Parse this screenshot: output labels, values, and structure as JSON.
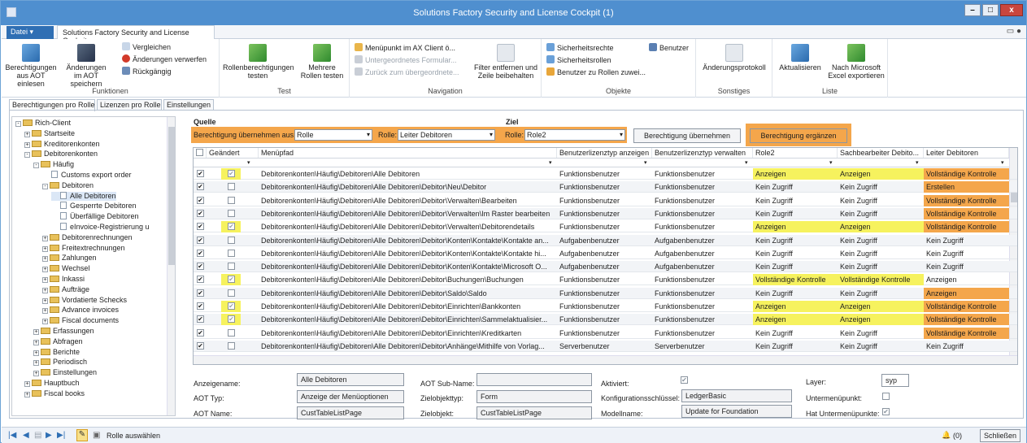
{
  "window": {
    "title": "Solutions Factory Security and License Cockpit (1)"
  },
  "menubar": {
    "file": "Datei",
    "tab": "Solutions Factory Security and License Cockpit"
  },
  "ribbon": {
    "funktionen": {
      "title": "Funktionen",
      "load": "Berechtigungen aus AOT einlesen",
      "save": "Änderungen im AOT speichern",
      "compare": "Vergleichen",
      "discard": "Änderungen verwerfen",
      "undo": "Rückgängig"
    },
    "test": {
      "title": "Test",
      "test_roles": "Rollenberechtigungen testen",
      "multi": "Mehrere Rollen testen"
    },
    "navigation": {
      "title": "Navigation",
      "open_ax": "Menüpunkt im AX Client ö...",
      "sub_form": "Untergeordnetes Formular...",
      "back": "Zurück zum übergeordnete...",
      "filter": "Filter entfernen und Zeile beibehalten"
    },
    "objekte": {
      "title": "Objekte",
      "rights": "Sicherheitsrechte",
      "roles": "Sicherheitsrollen",
      "assign": "Benutzer zu Rollen zuwei...",
      "users": "Benutzer"
    },
    "sonstiges": {
      "title": "Sonstiges",
      "log": "Änderungsprotokoll"
    },
    "liste": {
      "title": "Liste",
      "refresh": "Aktualisieren",
      "excel": "Nach Microsoft Excel exportieren"
    }
  },
  "tabs": [
    "Berechtigungen pro Rolle",
    "Lizenzen pro Rolle",
    "Einstellungen"
  ],
  "tree": [
    {
      "label": "Rich-Client",
      "level": 0,
      "type": "folder",
      "exp": "-"
    },
    {
      "label": "Startseite",
      "level": 1,
      "type": "folder",
      "exp": "+"
    },
    {
      "label": "Kreditorenkonten",
      "level": 1,
      "type": "folder",
      "exp": "+"
    },
    {
      "label": "Debitorenkonten",
      "level": 1,
      "type": "folder",
      "exp": "-"
    },
    {
      "label": "Häufig",
      "level": 2,
      "type": "folder",
      "exp": "-"
    },
    {
      "label": "Customs export order",
      "level": 3,
      "type": "doc",
      "exp": ""
    },
    {
      "label": "Debitoren",
      "level": 3,
      "type": "folder",
      "exp": "-"
    },
    {
      "label": "Alle Debitoren",
      "level": 4,
      "type": "doc",
      "exp": "",
      "selected": true
    },
    {
      "label": "Gesperrte Debitoren",
      "level": 4,
      "type": "doc",
      "exp": ""
    },
    {
      "label": "Überfällige Debitoren",
      "level": 4,
      "type": "doc",
      "exp": ""
    },
    {
      "label": "eInvoice-Registrierung u",
      "level": 4,
      "type": "doc",
      "exp": ""
    },
    {
      "label": "Debitorenrechnungen",
      "level": 3,
      "type": "folder",
      "exp": "+"
    },
    {
      "label": "Freitextrechnungen",
      "level": 3,
      "type": "folder",
      "exp": "+"
    },
    {
      "label": "Zahlungen",
      "level": 3,
      "type": "folder",
      "exp": "+"
    },
    {
      "label": "Wechsel",
      "level": 3,
      "type": "folder",
      "exp": "+"
    },
    {
      "label": "Inkassi",
      "level": 3,
      "type": "folder",
      "exp": "+"
    },
    {
      "label": "Aufträge",
      "level": 3,
      "type": "folder",
      "exp": "+"
    },
    {
      "label": "Vordatierte Schecks",
      "level": 3,
      "type": "folder",
      "exp": "+"
    },
    {
      "label": "Advance invoices",
      "level": 3,
      "type": "folder",
      "exp": "+"
    },
    {
      "label": "Fiscal documents",
      "level": 3,
      "type": "folder",
      "exp": "+"
    },
    {
      "label": "Erfassungen",
      "level": 2,
      "type": "folder",
      "exp": "+"
    },
    {
      "label": "Abfragen",
      "level": 2,
      "type": "folder",
      "exp": "+"
    },
    {
      "label": "Berichte",
      "level": 2,
      "type": "folder",
      "exp": "+"
    },
    {
      "label": "Periodisch",
      "level": 2,
      "type": "folder",
      "exp": "+"
    },
    {
      "label": "Einstellungen",
      "level": 2,
      "type": "folder",
      "exp": "+"
    },
    {
      "label": "Hauptbuch",
      "level": 1,
      "type": "folder",
      "exp": "+"
    },
    {
      "label": "Fiscal books",
      "level": 1,
      "type": "folder",
      "exp": "+"
    }
  ],
  "source": {
    "header": "Quelle",
    "take_label": "Berechtigung übernehmen aus:",
    "take_value": "Rolle",
    "role_label": "Rolle:",
    "role_value": "Leiter Debitoren"
  },
  "target": {
    "header": "Ziel",
    "role_label": "Rolle:",
    "role_value": "Role2",
    "apply": "Berechtigung übernehmen",
    "supplement": "Berechtigung ergänzen"
  },
  "grid": {
    "columns": [
      "Geändert",
      "Menüpfad",
      "Benutzerlizenztyp anzeigen",
      "Benutzerlizenztyp verwalten",
      "Role2",
      "Sachbearbeiter Debito...",
      "Leiter Debitoren"
    ],
    "rows": [
      {
        "sel": true,
        "chg": true,
        "path": "Debitorenkonten\\Häufig\\Debitoren\\Alle Debitoren",
        "show": "Funktionsbenutzer",
        "manage": "Funktionsbenutzer",
        "r2": "Anzeigen",
        "sb": "Anzeigen",
        "ld": "Vollständige Kontrolle",
        "h2": "y",
        "hs": "y",
        "hl": "o"
      },
      {
        "sel": true,
        "chg": false,
        "path": "Debitorenkonten\\Häufig\\Debitoren\\Alle Debitoren\\Debitor\\Neu\\Debitor",
        "show": "Funktionsbenutzer",
        "manage": "Funktionsbenutzer",
        "r2": "Kein Zugriff",
        "sb": "Kein Zugriff",
        "ld": "Erstellen",
        "h2": "",
        "hs": "",
        "hl": "o"
      },
      {
        "sel": true,
        "chg": false,
        "path": "Debitorenkonten\\Häufig\\Debitoren\\Alle Debitoren\\Debitor\\Verwalten\\Bearbeiten",
        "show": "Funktionsbenutzer",
        "manage": "Funktionsbenutzer",
        "r2": "Kein Zugriff",
        "sb": "Kein Zugriff",
        "ld": "Vollständige Kontrolle",
        "h2": "",
        "hs": "",
        "hl": "o"
      },
      {
        "sel": true,
        "chg": false,
        "path": "Debitorenkonten\\Häufig\\Debitoren\\Alle Debitoren\\Debitor\\Verwalten\\Im Raster bearbeiten",
        "show": "Funktionsbenutzer",
        "manage": "Funktionsbenutzer",
        "r2": "Kein Zugriff",
        "sb": "Kein Zugriff",
        "ld": "Vollständige Kontrolle",
        "h2": "",
        "hs": "",
        "hl": "o"
      },
      {
        "sel": true,
        "chg": true,
        "path": "Debitorenkonten\\Häufig\\Debitoren\\Alle Debitoren\\Debitor\\Verwalten\\Debitorendetails",
        "show": "Funktionsbenutzer",
        "manage": "Funktionsbenutzer",
        "r2": "Anzeigen",
        "sb": "Anzeigen",
        "ld": "Vollständige Kontrolle",
        "h2": "y",
        "hs": "y",
        "hl": "o"
      },
      {
        "sel": true,
        "chg": false,
        "path": "Debitorenkonten\\Häufig\\Debitoren\\Alle Debitoren\\Debitor\\Konten\\Kontakte\\Kontakte an...",
        "show": "Aufgabenbenutzer",
        "manage": "Aufgabenbenutzer",
        "r2": "Kein Zugriff",
        "sb": "Kein Zugriff",
        "ld": "Kein Zugriff",
        "h2": "",
        "hs": "",
        "hl": ""
      },
      {
        "sel": true,
        "chg": false,
        "path": "Debitorenkonten\\Häufig\\Debitoren\\Alle Debitoren\\Debitor\\Konten\\Kontakte\\Kontakte hi...",
        "show": "Aufgabenbenutzer",
        "manage": "Aufgabenbenutzer",
        "r2": "Kein Zugriff",
        "sb": "Kein Zugriff",
        "ld": "Kein Zugriff",
        "h2": "",
        "hs": "",
        "hl": ""
      },
      {
        "sel": true,
        "chg": false,
        "path": "Debitorenkonten\\Häufig\\Debitoren\\Alle Debitoren\\Debitor\\Konten\\Kontakte\\Microsoft O...",
        "show": "Aufgabenbenutzer",
        "manage": "Aufgabenbenutzer",
        "r2": "Kein Zugriff",
        "sb": "Kein Zugriff",
        "ld": "Kein Zugriff",
        "h2": "",
        "hs": "",
        "hl": ""
      },
      {
        "sel": true,
        "chg": true,
        "path": "Debitorenkonten\\Häufig\\Debitoren\\Alle Debitoren\\Debitor\\Buchungen\\Buchungen",
        "show": "Funktionsbenutzer",
        "manage": "Funktionsbenutzer",
        "r2": "Vollständige Kontrolle",
        "sb": "Vollständige Kontrolle",
        "ld": "Anzeigen",
        "h2": "y",
        "hs": "y",
        "hl": ""
      },
      {
        "sel": true,
        "chg": false,
        "path": "Debitorenkonten\\Häufig\\Debitoren\\Alle Debitoren\\Debitor\\Saldo\\Saldo",
        "show": "Funktionsbenutzer",
        "manage": "Funktionsbenutzer",
        "r2": "Kein Zugriff",
        "sb": "Kein Zugriff",
        "ld": "Anzeigen",
        "h2": "",
        "hs": "",
        "hl": "o"
      },
      {
        "sel": true,
        "chg": true,
        "path": "Debitorenkonten\\Häufig\\Debitoren\\Alle Debitoren\\Debitor\\Einrichten\\Bankkonten",
        "show": "Funktionsbenutzer",
        "manage": "Funktionsbenutzer",
        "r2": "Anzeigen",
        "sb": "Anzeigen",
        "ld": "Vollständige Kontrolle",
        "h2": "y",
        "hs": "y",
        "hl": "o"
      },
      {
        "sel": true,
        "chg": true,
        "path": "Debitorenkonten\\Häufig\\Debitoren\\Alle Debitoren\\Debitor\\Einrichten\\Sammelaktualisier...",
        "show": "Funktionsbenutzer",
        "manage": "Funktionsbenutzer",
        "r2": "Anzeigen",
        "sb": "Anzeigen",
        "ld": "Vollständige Kontrolle",
        "h2": "y",
        "hs": "y",
        "hl": "o"
      },
      {
        "sel": true,
        "chg": false,
        "path": "Debitorenkonten\\Häufig\\Debitoren\\Alle Debitoren\\Debitor\\Einrichten\\Kreditkarten",
        "show": "Funktionsbenutzer",
        "manage": "Funktionsbenutzer",
        "r2": "Kein Zugriff",
        "sb": "Kein Zugriff",
        "ld": "Vollständige Kontrolle",
        "h2": "",
        "hs": "",
        "hl": "o"
      },
      {
        "sel": true,
        "chg": false,
        "path": "Debitorenkonten\\Häufig\\Debitoren\\Alle Debitoren\\Debitor\\Anhänge\\Mithilfe von Vorlag...",
        "show": "Serverbenutzer",
        "manage": "Serverbenutzer",
        "r2": "Kein Zugriff",
        "sb": "Kein Zugriff",
        "ld": "Kein Zugriff",
        "h2": "",
        "hs": "",
        "hl": ""
      }
    ]
  },
  "details": {
    "display_name_label": "Anzeigename:",
    "display_name": "Alle Debitoren",
    "aot_type_label": "AOT Typ:",
    "aot_type": "Anzeige der Menüoptionen",
    "aot_name_label": "AOT Name:",
    "aot_name": "CustTableListPage",
    "aot_sub_label": "AOT Sub-Name:",
    "aot_sub": "",
    "target_type_label": "Zielobjekttyp:",
    "target_type": "Form",
    "target_obj_label": "Zielobjekt:",
    "target_obj": "CustTableListPage",
    "active_label": "Aktiviert:",
    "config_label": "Konfigurationsschlüssel:",
    "config": "LedgerBasic",
    "model_label": "Modellname:",
    "model": "Update for Foundation",
    "layer_label": "Layer:",
    "layer": "syp",
    "submenu_label": "Untermenüpunkt:",
    "has_sub_label": "Hat Untermenüpunkte:"
  },
  "status": {
    "select_role": "Rolle auswählen",
    "alerts": "(0)",
    "close": "Schließen"
  }
}
